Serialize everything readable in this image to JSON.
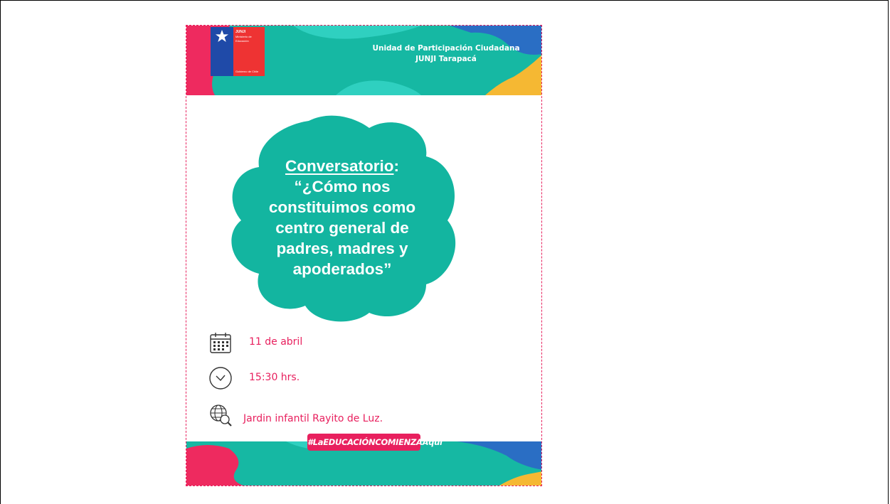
{
  "header": {
    "logo_name": "JUNJI",
    "logo_ministry": "Ministerio de Educación",
    "logo_government": "Gobierno de Chile",
    "org_line1": "Unidad de Participación Ciudadana",
    "org_line2": "JUNJI Tarapacá"
  },
  "title": {
    "label": "Conversatorio",
    "colon": ":",
    "line1": "“¿Cómo nos",
    "line2": "constituimos como",
    "line3": "centro general de",
    "line4": "padres, madres y",
    "line5": "apoderados”"
  },
  "details": {
    "date": "11 de abril",
    "time": "15:30 hrs.",
    "place": "Jardin infantil Rayito de Luz.",
    "date_icon": "calendar-icon",
    "time_icon": "clock-icon",
    "place_icon": "globe-search-icon"
  },
  "hashtag": "#LaEDUCACIÓNCOMIENZAAquí",
  "colors": {
    "accent_pink": "#e8205e",
    "teal": "#13b5a0",
    "yellow": "#f5b833",
    "blue": "#2a6ec4"
  }
}
